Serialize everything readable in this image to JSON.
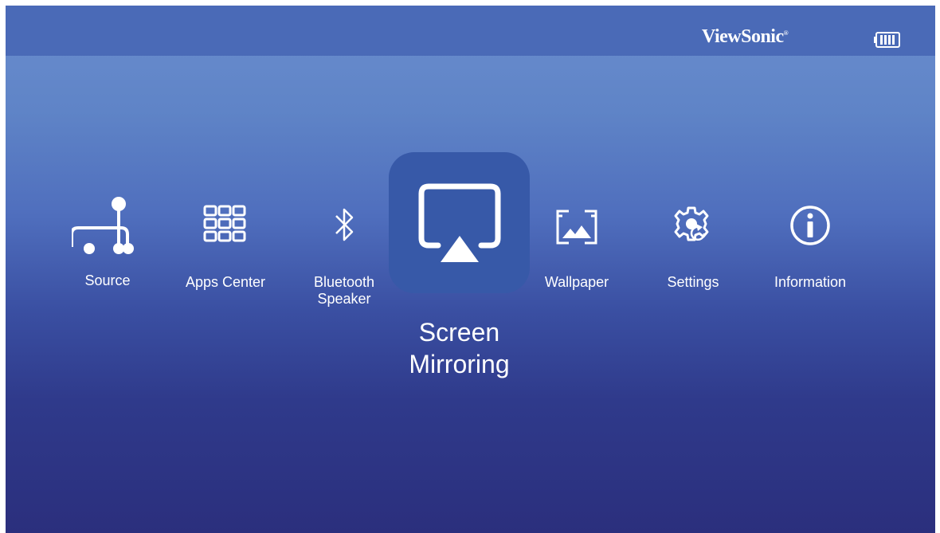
{
  "header": {
    "brand": "ViewSonic",
    "brand_mark": "®",
    "battery_icon": "battery-icon"
  },
  "menu": {
    "items": [
      {
        "label": "Source",
        "icon": "source-icon"
      },
      {
        "label": "Apps Center",
        "icon": "apps-grid-icon"
      },
      {
        "label": "Bluetooth\nSpeaker",
        "icon": "bluetooth-icon"
      },
      {
        "label": "Screen\nMirroring",
        "icon": "screen-mirroring-icon",
        "selected": true
      },
      {
        "label": "Wallpaper",
        "icon": "wallpaper-icon"
      },
      {
        "label": "Settings",
        "icon": "gear-icon"
      },
      {
        "label": "Information",
        "icon": "info-icon"
      }
    ]
  },
  "colors": {
    "selected_tile": "#3759a8",
    "header_bar": "#4a6ab7",
    "text": "#ffffff"
  }
}
